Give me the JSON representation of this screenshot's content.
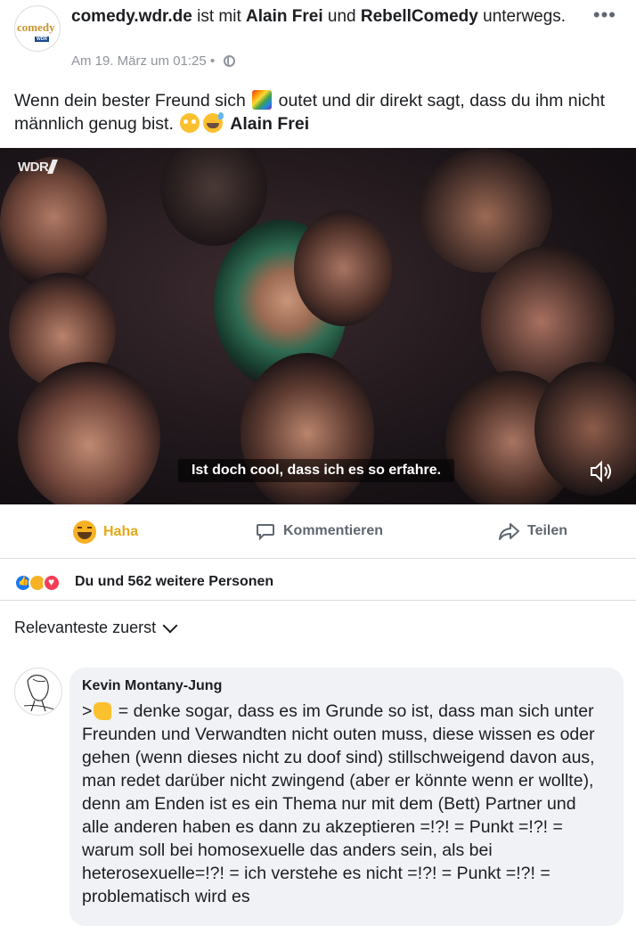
{
  "post": {
    "page_name": "comedy.wdr.de",
    "connector_1": " ist mit ",
    "with_1": "Alain Frei",
    "connector_2": " und ",
    "with_2": "RebellComedy",
    "connector_3": " unterwegs.",
    "timestamp": "Am 19. März um 01:25",
    "separator": " • ",
    "avatar_text": "comedy",
    "avatar_sub": "WDR",
    "text_part1": "Wenn dein bester Freund sich ",
    "text_part2": " outet und dir direkt sagt, dass du ihm nicht männlich genug bist. ",
    "tagged": "Alain Frei",
    "more_icon": "•••"
  },
  "video": {
    "logo": "WDR",
    "subtitle": "Ist doch cool, dass ich es so erfahre."
  },
  "actions": {
    "haha": "Haha",
    "comment": "Kommentieren",
    "share": "Teilen"
  },
  "reactions": {
    "summary": "Du und 562 weitere Personen"
  },
  "comments": {
    "sort_label": "Relevanteste zuerst",
    "items": [
      {
        "author": "Kevin Montany-Jung",
        "text_prefix": ">",
        "text": " = denke sogar, dass es im Grunde  so ist, dass man sich unter Freunden und Verwandten nicht outen  muss, diese wissen es oder gehen (wenn dieses nicht zu doof sind) stillschweigend davon aus, man redet darüber nicht zwingend (aber er könnte wenn er wollte), denn am Enden ist es ein Thema nur mit dem (Bett) Partner und alle anderen haben es dann zu akzeptieren =!?! = Punkt =!?! = warum soll bei homosexuelle das anders sein, als bei heterosexuelle=!?! = ich verstehe es nicht =!?! = Punkt =!?! = problematisch wird es"
      }
    ]
  },
  "colors": {
    "link": "#1c1e21",
    "meta": "#90949c",
    "haha": "#e6a817",
    "like": "#1877f2",
    "love": "#f33e58"
  }
}
